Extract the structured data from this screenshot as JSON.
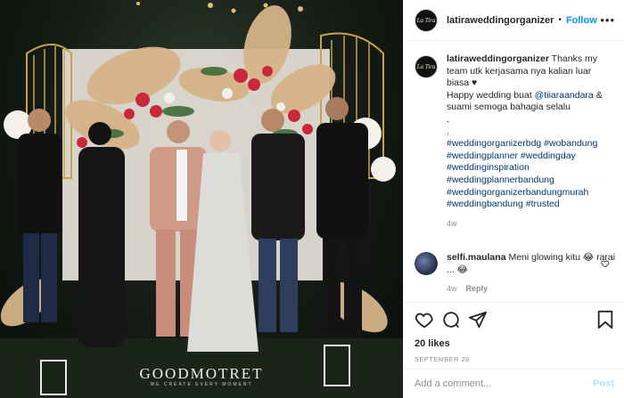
{
  "photo": {
    "watermark": "GOODMOTRET",
    "watermark_sub": "WE CREATE EVERY MOMENT"
  },
  "header": {
    "avatar_text": "La Tira",
    "username": "latiraweddingorganizer",
    "separator": "•",
    "follow_label": "Follow",
    "more_icon": "more-icon"
  },
  "caption": {
    "username": "latiraweddingorganizer",
    "text1": "Thanks my team utk kerjasama nya kalian luar biasa ♥",
    "text2a": "Happy wedding buat ",
    "mention": "@tiiaraandara",
    "text2b": " & suami semoga bahagia selalu",
    "dot1": ".",
    "dot2": ".",
    "hashtags": [
      "#weddingorganizerbdg #wobandung",
      "#weddingplanner #weddingday",
      "#weddinginspiration",
      "#weddingplannerbandung",
      "#weddingorganizerbandungmurah",
      "#weddingbandung #trusted"
    ],
    "time": "4w"
  },
  "comment": {
    "username": "selfi.maulana",
    "text": "Meni glowing kitu 😂 rarai ... 😂",
    "time": "4w",
    "reply_label": "Reply"
  },
  "actions": {
    "likes": "20 likes",
    "date": "SEPTEMBER 29"
  },
  "add_comment": {
    "placeholder": "Add a comment...",
    "post_label": "Post"
  },
  "colors": {
    "follow": "#0095f6",
    "hashtag": "#00376b",
    "muted": "#8e8e8e",
    "post_disabled": "#b2dffc"
  }
}
